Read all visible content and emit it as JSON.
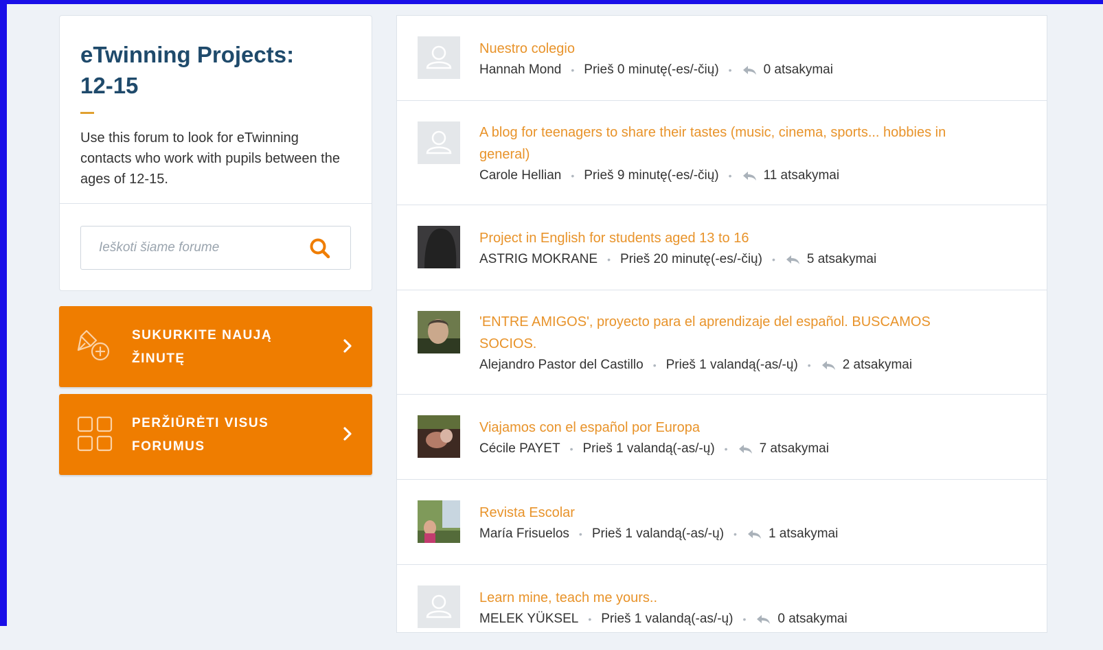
{
  "sidebar": {
    "title_line1": "eTwinning Projects:",
    "title_line2": "12-15",
    "description": "Use this forum to look for eTwinning contacts who work with pupils between the ages of 12-15.",
    "search_placeholder": "Ieškoti šiame forume",
    "create_button_line1": "SUKURKITE NAUJĄ",
    "create_button_line2": "ŽINUTĘ",
    "all_forums_line1": "PERŽIŪRĖTI VISUS",
    "all_forums_line2": "FORUMUS"
  },
  "colors": {
    "accent": "#ef7d00",
    "title": "#1f4a6b",
    "link": "#e8932a",
    "frame": "#1a0fe8"
  },
  "threads": [
    {
      "title": "Nuestro colegio",
      "author": "Hannah Mond",
      "time": "Prieš 0 minutę(-es/-čių)",
      "replies": "0 atsakymai",
      "avatar": "default-avatar"
    },
    {
      "title": "A blog for teenagers to share their tastes (music, cinema, sports... hobbies in general)",
      "author": "Carole Hellian",
      "time": "Prieš 9 minutę(-es/-čių)",
      "replies": "11 atsakymai",
      "avatar": "default-avatar"
    },
    {
      "title": "Project in English for students aged 13 to 16",
      "author": "ASTRIG MOKRANE",
      "time": "Prieš 20 minutę(-es/-čių)",
      "replies": "5 atsakymai",
      "avatar": "photo-avatar"
    },
    {
      "title": "'ENTRE AMIGOS', proyecto para el aprendizaje del español. BUSCAMOS SOCIOS.",
      "author": "Alejandro Pastor del Castillo",
      "time": "Prieš 1 valandą(-as/-ų)",
      "replies": "2 atsakymai",
      "avatar": "photo-avatar"
    },
    {
      "title": "Viajamos con el español por Europa",
      "author": "Cécile PAYET",
      "time": "Prieš 1 valandą(-as/-ų)",
      "replies": "7 atsakymai",
      "avatar": "photo-avatar"
    },
    {
      "title": "Revista Escolar",
      "author": "María Frisuelos",
      "time": "Prieš 1 valandą(-as/-ų)",
      "replies": "1 atsakymai",
      "avatar": "photo-avatar"
    },
    {
      "title": "Learn mine, teach me yours..",
      "author": "MELEK YÜKSEL",
      "time": "Prieš 1 valandą(-as/-ų)",
      "replies": "0 atsakymai",
      "avatar": "default-avatar"
    }
  ]
}
